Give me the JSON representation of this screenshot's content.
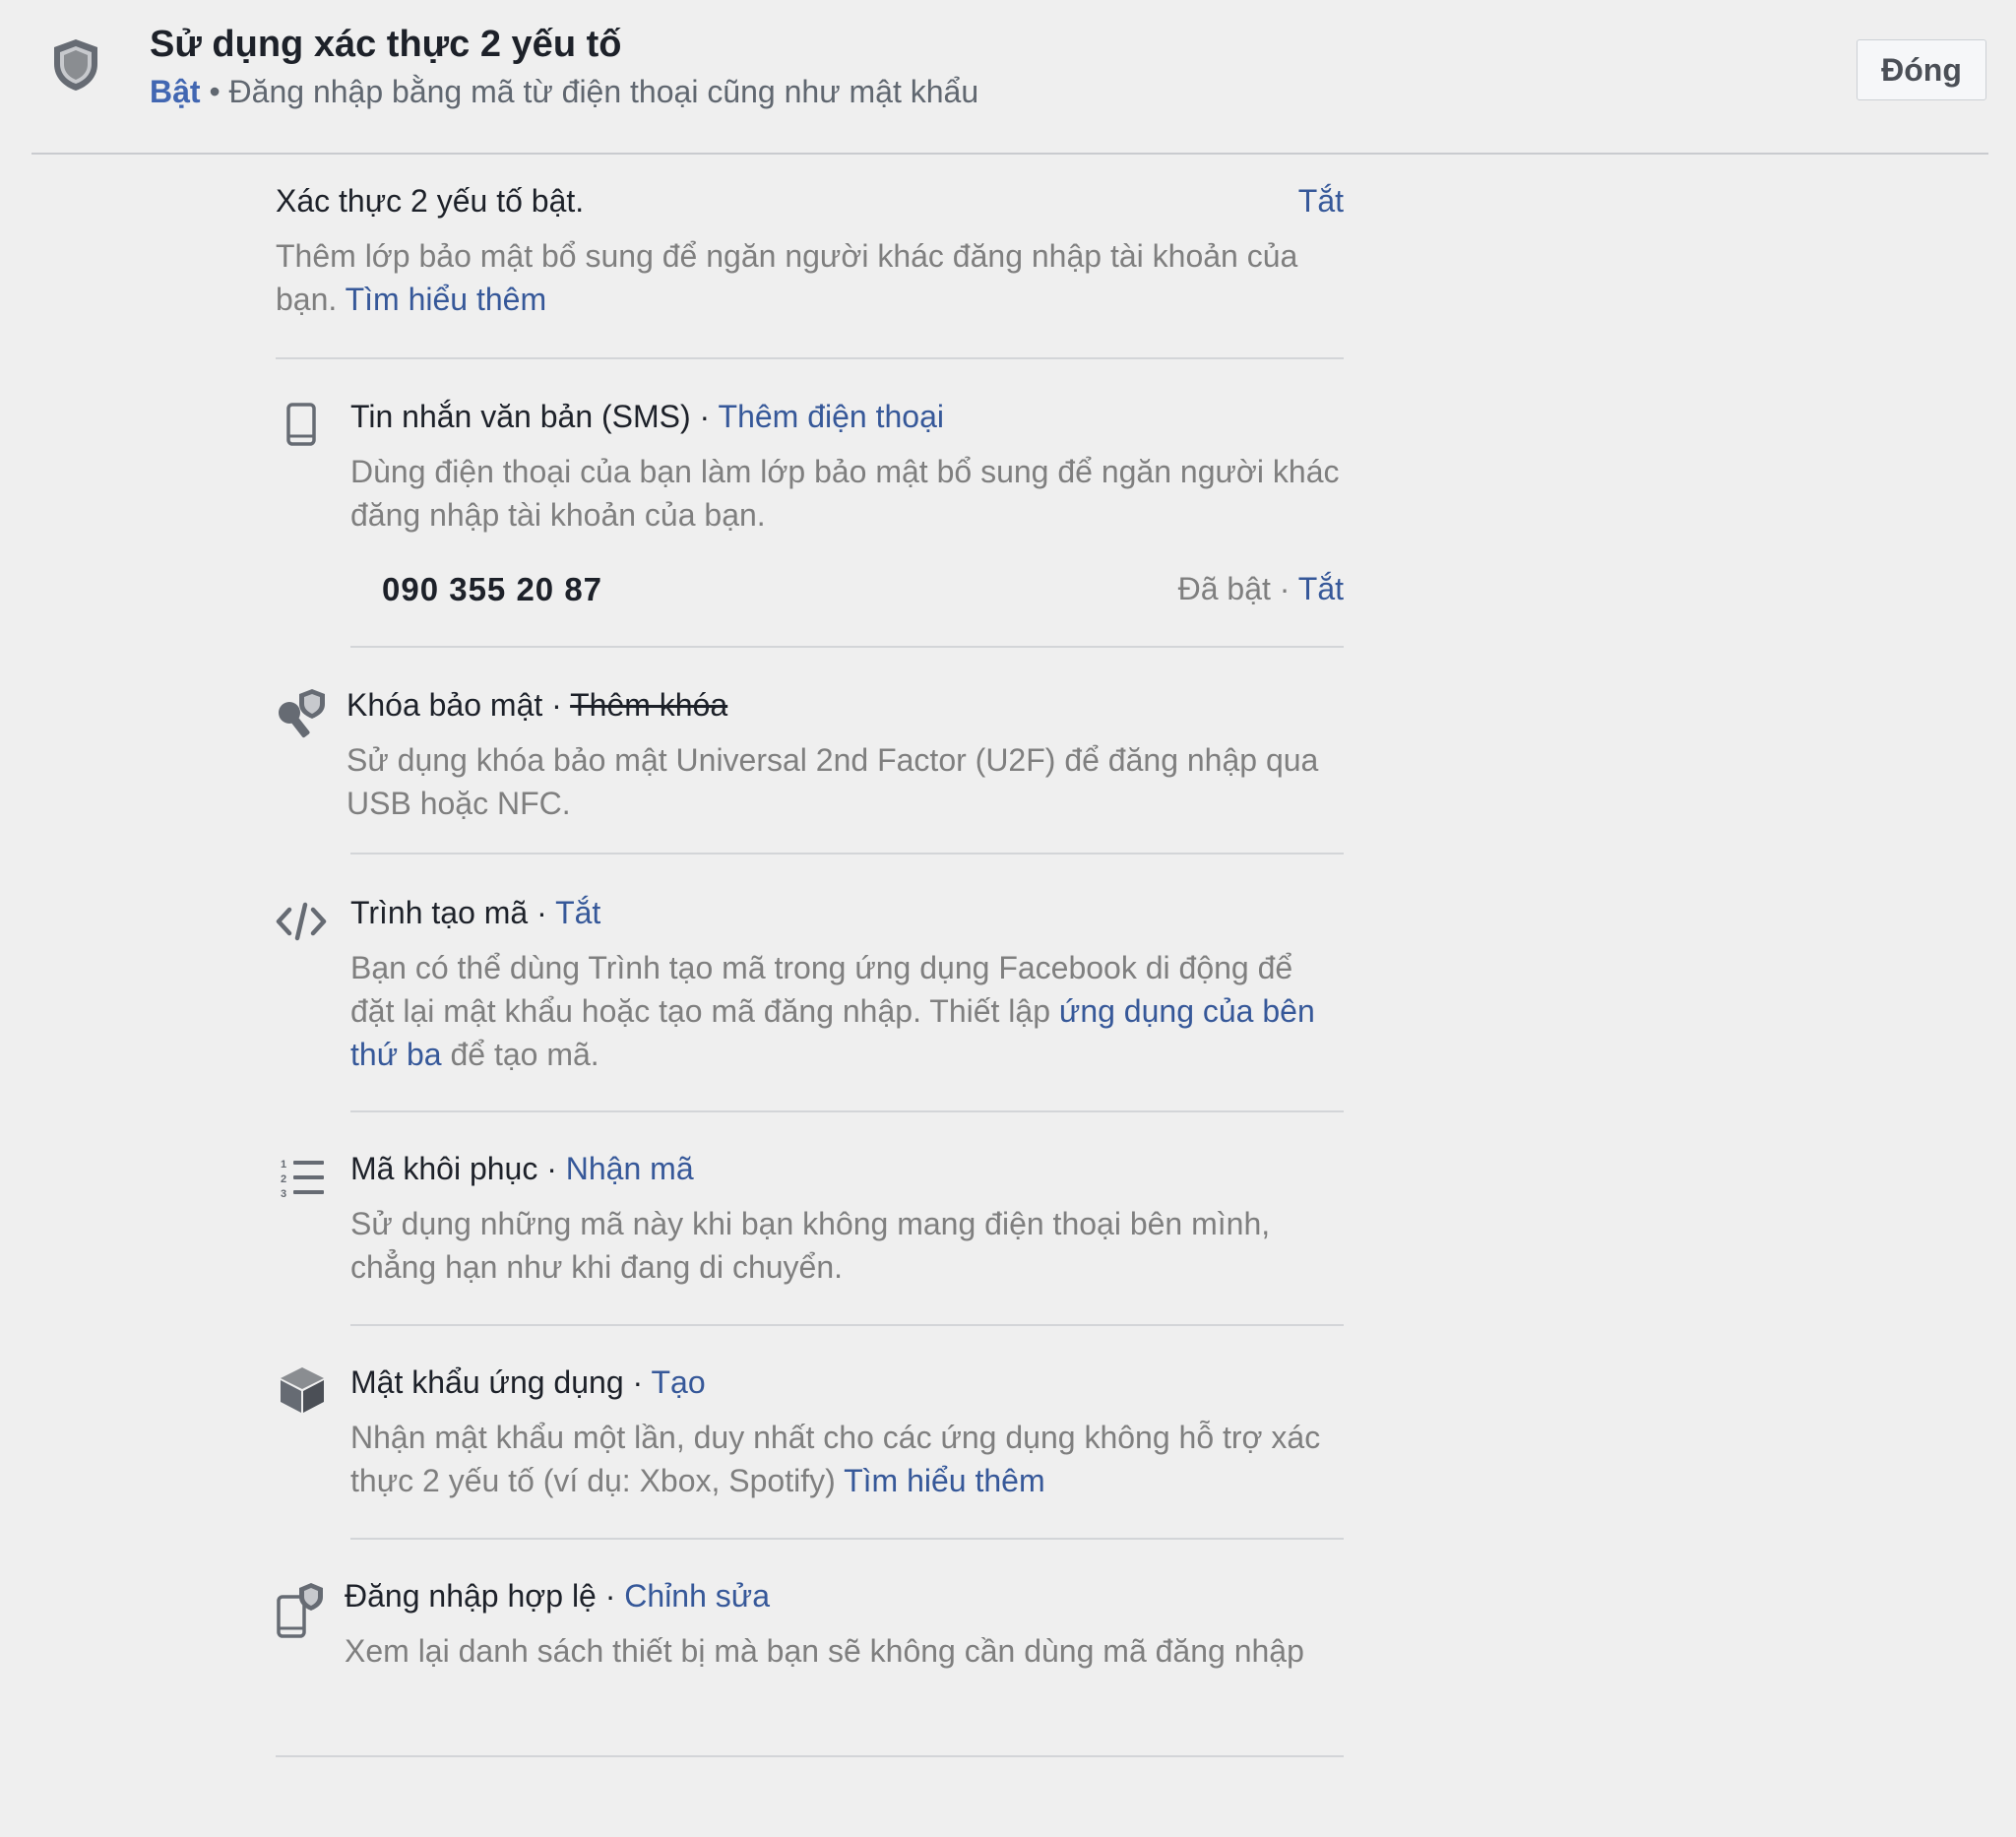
{
  "header": {
    "title": "Sử dụng xác thực 2 yếu tố",
    "status": "Bật",
    "separator": "•",
    "subtitle": "Đăng nhập bằng mã từ điện thoại cũng như mật khẩu",
    "close_label": "Đóng"
  },
  "intro": {
    "title": "Xác thực 2 yếu tố bật.",
    "off_label": "Tắt",
    "description": "Thêm lớp bảo mật bổ sung để ngăn người khác đăng nhập tài khoản của bạn.",
    "learn_more": "Tìm hiểu thêm"
  },
  "methods": {
    "sms": {
      "title": "Tin nhắn văn bản (SMS)",
      "dot": " · ",
      "action": "Thêm điện thoại",
      "description": "Dùng điện thoại của bạn làm lớp bảo mật bổ sung để ngăn người khác đăng nhập tài khoản của bạn.",
      "phone": "090 355 20 87",
      "phone_status": "Đã bật",
      "phone_dot": " · ",
      "phone_action": "Tắt"
    },
    "security_key": {
      "title": "Khóa bảo mật",
      "dot": " · ",
      "action": "Thêm khóa",
      "description": "Sử dụng khóa bảo mật Universal 2nd Factor (U2F) để đăng nhập qua USB hoặc NFC."
    },
    "code_generator": {
      "title": "Trình tạo mã",
      "dot": " · ",
      "action": "Tắt",
      "description_before": "Bạn có thể dùng Trình tạo mã trong ứng dụng Facebook di động để đặt lại mật khẩu hoặc tạo mã đăng nhập. Thiết lập ",
      "description_link": "ứng dụng của bên thứ ba",
      "description_after": " để tạo mã."
    },
    "recovery_codes": {
      "title": "Mã khôi phục",
      "dot": " · ",
      "action": "Nhận mã",
      "description": "Sử dụng những mã này khi bạn không mang điện thoại bên mình, chẳng hạn như khi đang di chuyển."
    },
    "app_passwords": {
      "title": "Mật khẩu ứng dụng",
      "dot": " · ",
      "action": "Tạo",
      "description": "Nhận mật khẩu một lần, duy nhất cho các ứng dụng không hỗ trợ xác thực 2 yếu tố (ví dụ: Xbox, Spotify) ",
      "learn_more": "Tìm hiểu thêm"
    },
    "authorized_logins": {
      "title": "Đăng nhập hợp lệ",
      "dot": " · ",
      "action": "Chỉnh sửa",
      "description": "Xem lại danh sách thiết bị mà bạn sẽ không cần dùng mã đăng nhập"
    }
  },
  "colors": {
    "background": "#efefef",
    "link": "#365899",
    "status_on": "#4267b2",
    "muted_text": "#7f7f7f",
    "icon": "#666b73"
  },
  "icons": {
    "header": "shield-icon",
    "sms": "phone-icon",
    "security_key": "key-shield-icon",
    "code_generator": "code-icon",
    "recovery_codes": "numbered-list-icon",
    "app_passwords": "cube-icon",
    "authorized_logins": "phone-shield-icon"
  }
}
